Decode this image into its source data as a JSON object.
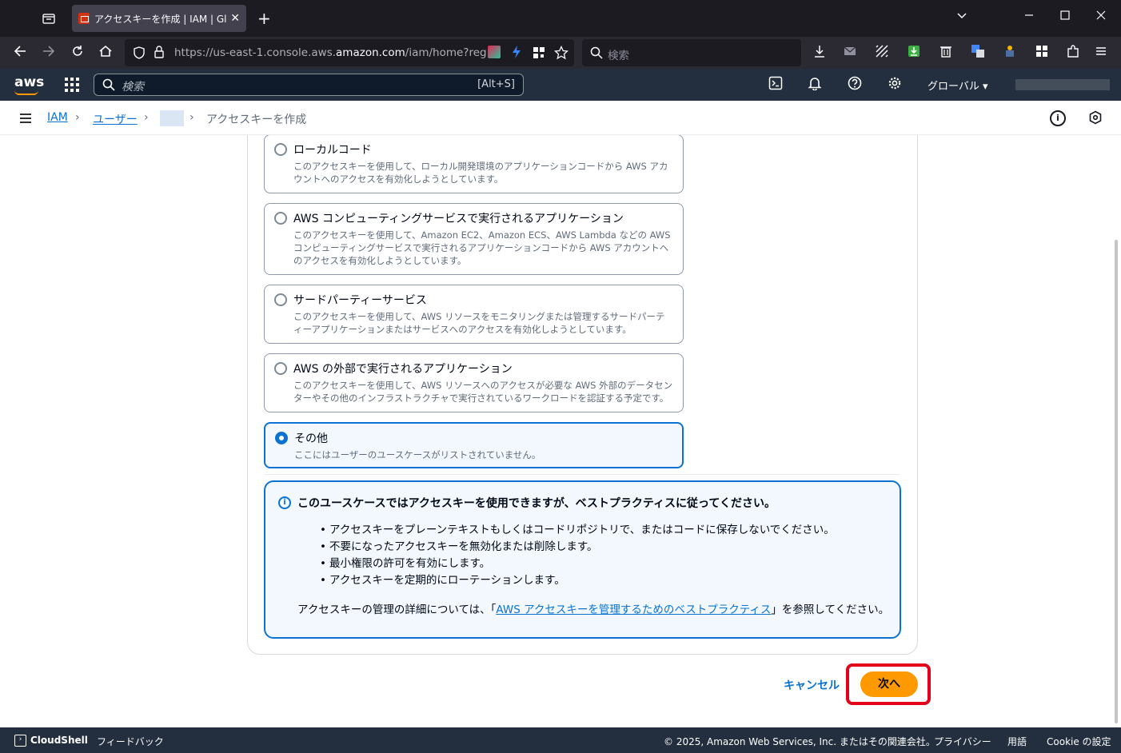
{
  "browser": {
    "tab_title": "アクセスキーを作成 | IAM | Global",
    "url_prefix": "https://us-east-1.console.aws.",
    "url_domain": "amazon.com",
    "url_suffix": "/iam/home?region=",
    "search_placeholder": "検索",
    "new_tab": "+",
    "close": "✕"
  },
  "aws_header": {
    "logo": "aws",
    "search_placeholder": "検索",
    "search_shortcut": "[Alt+S]",
    "region": "グローバル ▾"
  },
  "breadcrumb": {
    "items": [
      "IAM",
      "ユーザー"
    ],
    "current": "アクセスキーを作成"
  },
  "options": [
    {
      "title": "ローカルコード",
      "desc": "このアクセスキーを使用して、ローカル開発環境のアプリケーションコードから AWS アカウントへのアクセスを有効化しようとしています。",
      "selected": false
    },
    {
      "title": "AWS コンピューティングサービスで実行されるアプリケーション",
      "desc": "このアクセスキーを使用して、Amazon EC2、Amazon ECS、AWS Lambda などの AWS コンピューティングサービスで実行されるアプリケーションコードから AWS アカウントへのアクセスを有効化しようとしています。",
      "selected": false
    },
    {
      "title": "サードパーティーサービス",
      "desc": "このアクセスキーを使用して、AWS リソースをモニタリングまたは管理するサードパーティーアプリケーションまたはサービスへのアクセスを有効化しようとしています。",
      "selected": false
    },
    {
      "title": "AWS の外部で実行されるアプリケーション",
      "desc": "このアクセスキーを使用して、AWS リソースへのアクセスが必要な AWS 外部のデータセンターやその他のインフラストラクチャで実行されているワークロードを認証する予定です。",
      "selected": false
    },
    {
      "title": "その他",
      "desc": "ここにはユーザーのユースケースがリストされていません。",
      "selected": true
    }
  ],
  "alert": {
    "title": "このユースケースではアクセスキーを使用できますが、ベストプラクティスに従ってください。",
    "items": [
      "アクセスキーをプレーンテキストもしくはコードリポジトリで、またはコードに保存しないでください。",
      "不要になったアクセスキーを無効化または削除します。",
      "最小権限の許可を有効にします。",
      "アクセスキーを定期的にローテーションします。"
    ],
    "footer_prefix": "アクセスキーの管理の詳細については、「",
    "footer_link": "AWS アクセスキーを管理するためのベストプラクティス",
    "footer_suffix": "」を参照してください。"
  },
  "actions": {
    "cancel": "キャンセル",
    "next": "次へ"
  },
  "footer": {
    "cloudshell": "CloudShell",
    "feedback": "フィードバック",
    "copyright": "© 2025, Amazon Web Services, Inc. またはその関連会社。",
    "privacy": "プライバシー",
    "terms": "用語",
    "cookie": "Cookie の設定"
  }
}
